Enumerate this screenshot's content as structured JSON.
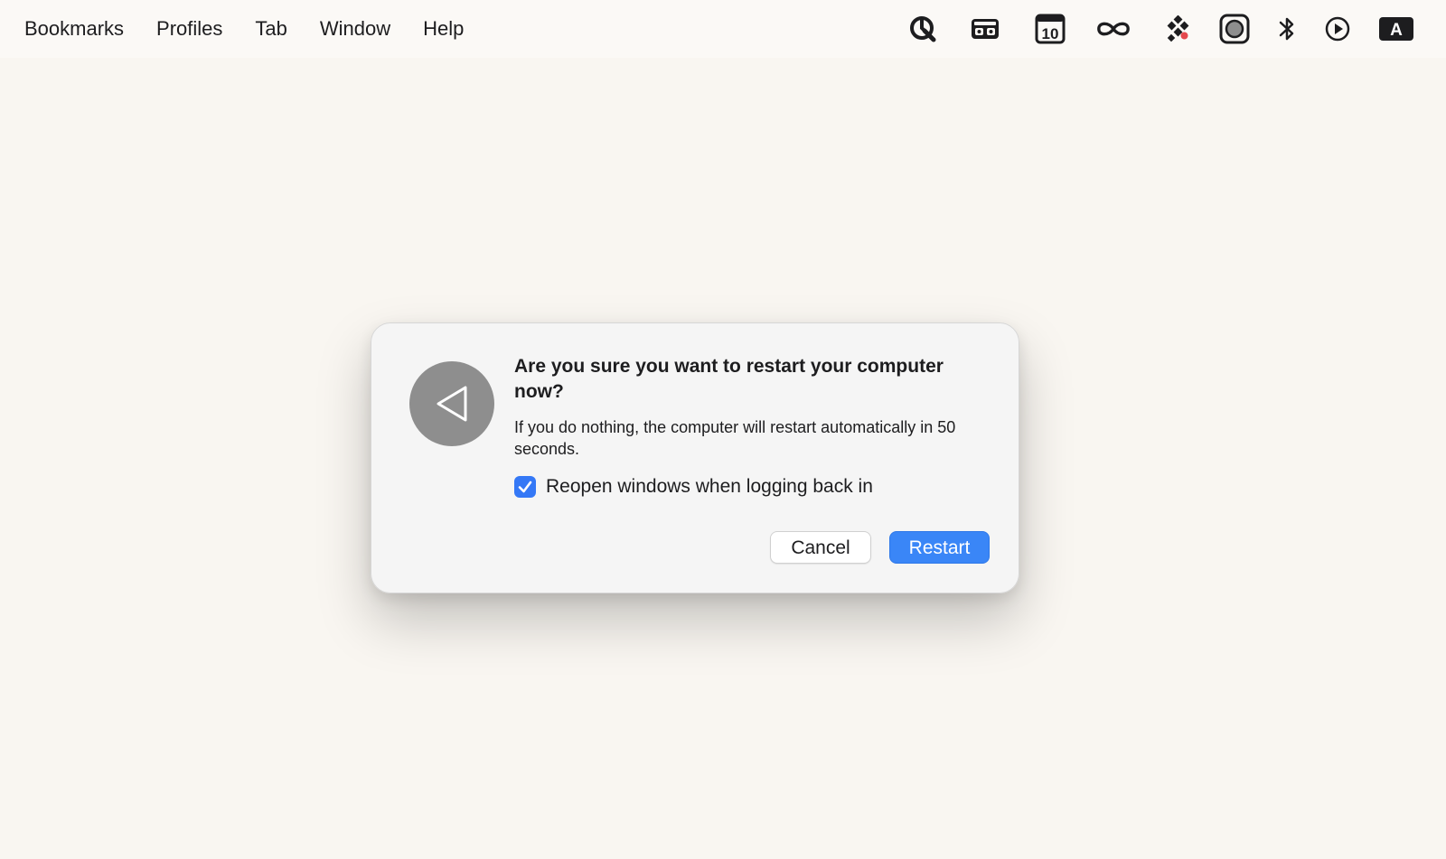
{
  "menubar": {
    "items": [
      "Bookmarks",
      "Profiles",
      "Tab",
      "Window",
      "Help"
    ],
    "tray_icons": [
      "quicklook-icon",
      "cassette-icon",
      "calendar-10-icon",
      "infinity-icon",
      "dots-grid-icon",
      "screen-record-icon",
      "bluetooth-icon",
      "play-circle-icon",
      "input-source-icon"
    ],
    "calendar_day": "10",
    "input_source_letter": "A"
  },
  "dialog": {
    "title": "Are you sure you want to restart your computer now?",
    "message": "If you do nothing, the computer will restart automatically in 50 seconds.",
    "checkbox_label": "Reopen windows when logging back in",
    "checkbox_checked": true,
    "cancel_label": "Cancel",
    "restart_label": "Restart",
    "icon": "restart-triangle-icon"
  },
  "colors": {
    "accent": "#3a86f7",
    "icon_gray": "#8e8e8e",
    "background": "#f9f6f1"
  }
}
